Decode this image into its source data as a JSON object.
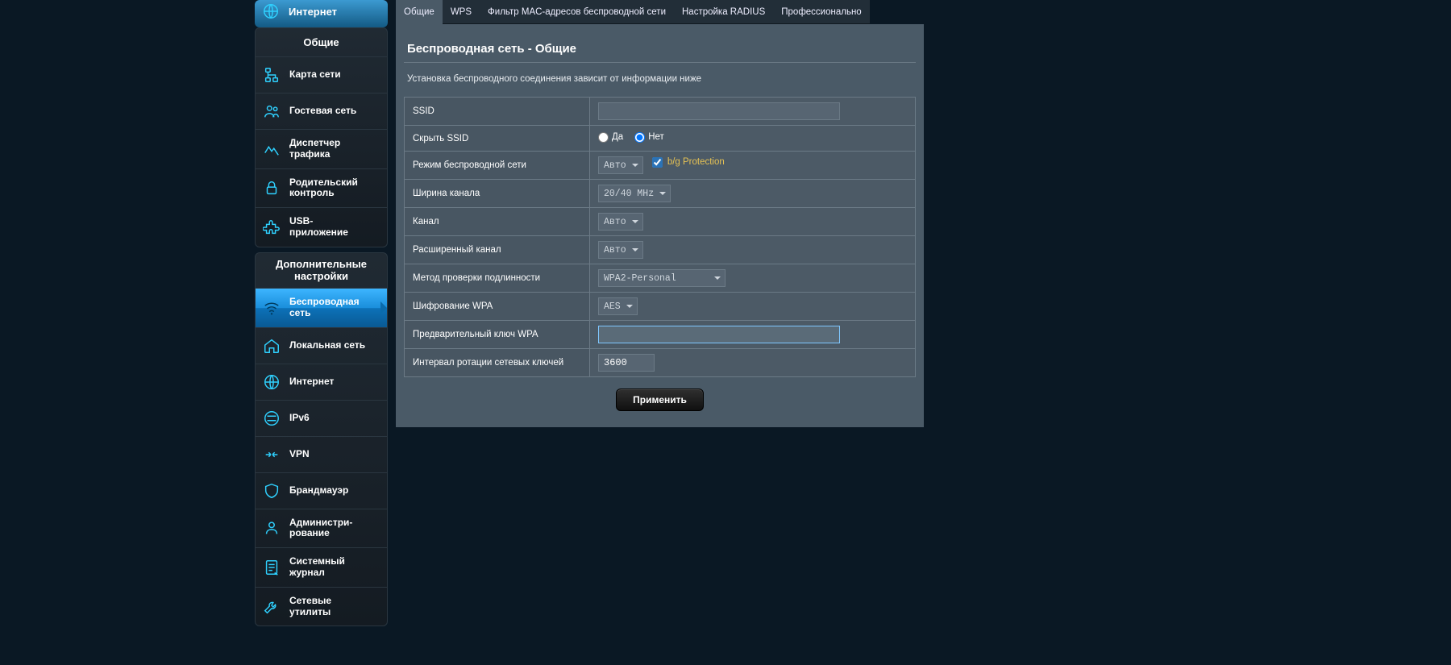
{
  "sidebar": {
    "top": {
      "label": "Интернет"
    },
    "general": {
      "header": "Общие",
      "items": [
        {
          "label": "Карта сети",
          "icon": "network-map-icon"
        },
        {
          "label": "Гостевая сеть",
          "icon": "guest-icon"
        },
        {
          "label1": "Диспетчер",
          "label2": "трафика",
          "icon": "traffic-icon"
        },
        {
          "label1": "Родительский",
          "label2": "контроль",
          "icon": "lock-icon"
        },
        {
          "label1": "USB-",
          "label2": "приложение",
          "icon": "puzzle-icon"
        }
      ]
    },
    "advanced": {
      "header1": "Дополнительные",
      "header2": "настройки",
      "items": [
        {
          "label1": "Беспроводная",
          "label2": "сеть",
          "icon": "wifi-icon",
          "active": true
        },
        {
          "label": "Локальная сеть",
          "icon": "home-icon"
        },
        {
          "label": "Интернет",
          "icon": "globe-icon"
        },
        {
          "label": "IPv6",
          "icon": "ipv6-icon"
        },
        {
          "label": "VPN",
          "icon": "vpn-icon"
        },
        {
          "label": "Брандмауэр",
          "icon": "shield-icon"
        },
        {
          "label1": "Администри-",
          "label2": "рование",
          "icon": "admin-icon"
        },
        {
          "label1": "Системный",
          "label2": "журнал",
          "icon": "log-icon"
        },
        {
          "label1": "Сетевые",
          "label2": "утилиты",
          "icon": "tools-icon"
        }
      ]
    }
  },
  "tabs": [
    "Общие",
    "WPS",
    "Фильтр MAC-адресов беспроводной сети",
    "Настройка RADIUS",
    "Профессионально"
  ],
  "page": {
    "title": "Беспроводная сеть - Общие",
    "desc": "Установка беспроводного соединения зависит от информации ниже"
  },
  "form": {
    "ssid_label": "SSID",
    "ssid_value": "",
    "hide_ssid_label": "Скрыть SSID",
    "yes": "Да",
    "no": "Нет",
    "hide_ssid": "no",
    "mode_label": "Режим беспроводной сети",
    "mode_value": "Авто",
    "bg_protection": "b/g Protection",
    "bg_checked": true,
    "width_label": "Ширина канала",
    "width_value": "20/40 MHz",
    "channel_label": "Канал",
    "channel_value": "Авто",
    "ext_channel_label": "Расширенный канал",
    "ext_channel_value": "Авто",
    "auth_label": "Метод проверки подлинности",
    "auth_value": "WPA2-Personal",
    "enc_label": "Шифрование WPA",
    "enc_value": "AES",
    "psk_label": "Предварительный ключ WPA",
    "psk_value": "",
    "rotate_label": "Интервал ротации сетевых ключей",
    "rotate_value": "3600",
    "apply": "Применить"
  }
}
